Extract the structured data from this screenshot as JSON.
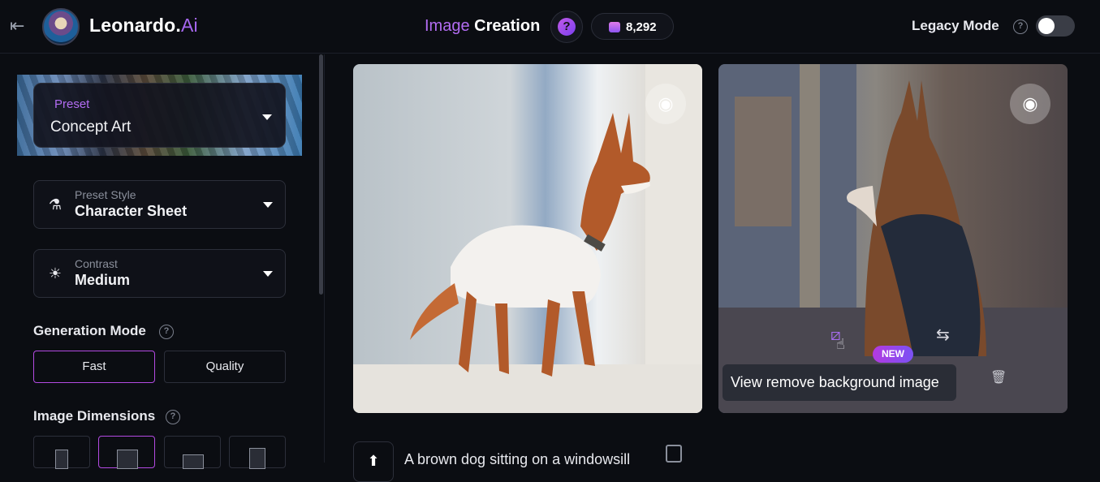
{
  "header": {
    "brand_name": "Leonardo.",
    "brand_suffix": "Ai",
    "page_title_accent": "Image",
    "page_title": "Creation",
    "help_label": "?",
    "tokens": "8,292",
    "legacy_mode_label": "Legacy Mode",
    "legacy_mode_on": false
  },
  "sidebar": {
    "preset": {
      "label": "Preset",
      "value": "Concept Art"
    },
    "preset_style": {
      "label": "Preset Style",
      "value": "Character Sheet"
    },
    "contrast": {
      "label": "Contrast",
      "value": "Medium"
    },
    "generation_mode": {
      "title": "Generation Mode",
      "options": [
        "Fast",
        "Quality"
      ],
      "selected": "Fast"
    },
    "image_dimensions": {
      "title": "Image Dimensions"
    }
  },
  "gallery": {
    "new_badge": "NEW",
    "tooltip": "View remove background image",
    "prompt": "A brown dog sitting on a windowsill"
  },
  "colors": {
    "accent": "#b26cf2",
    "active_border": "#b34ae2",
    "background": "#0b0d12"
  }
}
